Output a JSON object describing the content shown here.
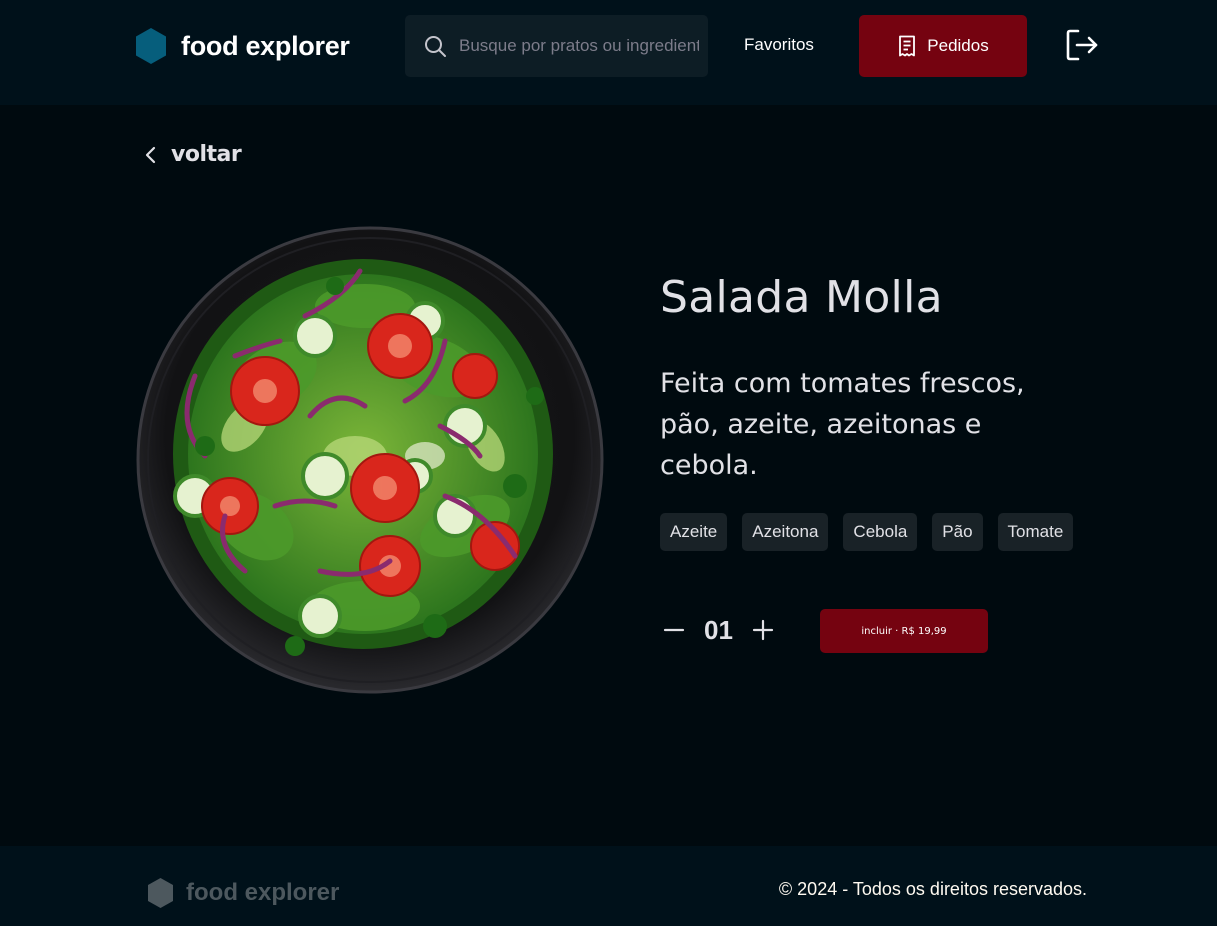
{
  "header": {
    "brand": "food explorer",
    "brand_icon": "hexagon-logo-icon",
    "search_placeholder": "Busque por pratos ou ingredientes",
    "favorites_label": "Favoritos",
    "orders_label": "Pedidos",
    "orders_icon": "receipt-icon",
    "logout_icon": "sign-out-icon"
  },
  "back": {
    "label": "voltar",
    "icon": "chevron-left-icon"
  },
  "dish": {
    "image": "salad-bowl-image",
    "title": "Salada Molla",
    "description": "Feita com tomates frescos, pão, azeite, azeitonas e cebola.",
    "ingredients": [
      "Azeite",
      "Azeitona",
      "Cebola",
      "Pão",
      "Tomate"
    ],
    "quantity": "01",
    "include_label": "incluir · R$ 19,99"
  },
  "footer": {
    "brand": "food explorer",
    "copyright": "© 2024 - Todos os direitos reservados."
  },
  "colors": {
    "background": "#000A0F",
    "header_bg": "#00111A",
    "accent_red": "#750310",
    "logo_blue": "#065E7C",
    "tag_bg": "#192227",
    "search_bg": "#0D1D25"
  }
}
